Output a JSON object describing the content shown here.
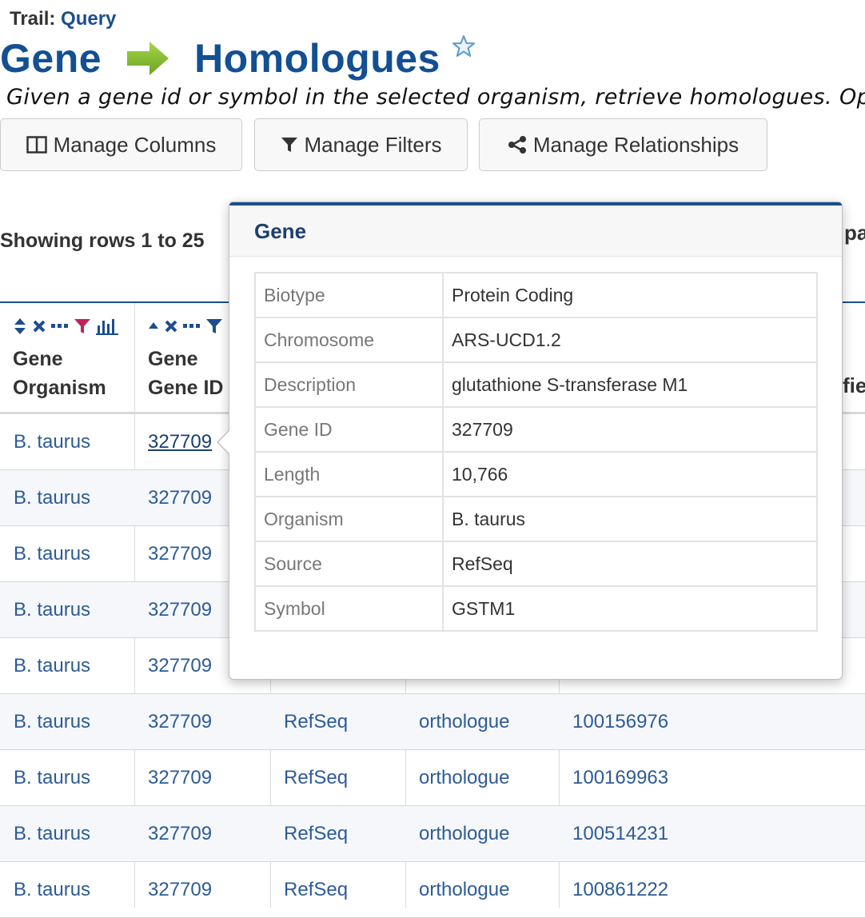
{
  "trail": {
    "label": "Trail:",
    "link": "Query"
  },
  "title": {
    "from": "Gene",
    "to": "Homologues"
  },
  "description": "Given a gene id or symbol in the selected organism, retrieve homologues. Optio",
  "toolbar": {
    "manage_columns": "Manage Columns",
    "manage_filters": "Manage Filters",
    "manage_relationships": "Manage Relationships"
  },
  "showing": "Showing rows 1 to 25",
  "right_fragment": "pa",
  "header_fragment": "fie",
  "columns": [
    {
      "line1": "Gene",
      "line2": "Organism"
    },
    {
      "line1": "Gene",
      "line2": "Gene ID"
    }
  ],
  "rows": [
    {
      "organism": "B. taurus",
      "gene_id": "327709",
      "source": "",
      "type": "",
      "homologue_id": ""
    },
    {
      "organism": "B. taurus",
      "gene_id": "327709",
      "source": "",
      "type": "",
      "homologue_id": ""
    },
    {
      "organism": "B. taurus",
      "gene_id": "327709",
      "source": "",
      "type": "",
      "homologue_id": ""
    },
    {
      "organism": "B. taurus",
      "gene_id": "327709",
      "source": "",
      "type": "",
      "homologue_id": ""
    },
    {
      "organism": "B. taurus",
      "gene_id": "327709",
      "source": "",
      "type": "",
      "homologue_id": ""
    },
    {
      "organism": "B. taurus",
      "gene_id": "327709",
      "source": "RefSeq",
      "type": "orthologue",
      "homologue_id": "100156976"
    },
    {
      "organism": "B. taurus",
      "gene_id": "327709",
      "source": "RefSeq",
      "type": "orthologue",
      "homologue_id": "100169963"
    },
    {
      "organism": "B. taurus",
      "gene_id": "327709",
      "source": "RefSeq",
      "type": "orthologue",
      "homologue_id": "100514231"
    },
    {
      "organism": "B. taurus",
      "gene_id": "327709",
      "source": "RefSeq",
      "type": "orthologue",
      "homologue_id": "100861222"
    }
  ],
  "popover": {
    "title": "Gene",
    "fields": [
      {
        "key": "Biotype",
        "value": "Protein Coding"
      },
      {
        "key": "Chromosome",
        "value": "ARS-UCD1.2"
      },
      {
        "key": "Description",
        "value": "glutathione S-transferase M1"
      },
      {
        "key": "Gene ID",
        "value": "327709"
      },
      {
        "key": "Length",
        "value": "10,766"
      },
      {
        "key": "Organism",
        "value": "B. taurus"
      },
      {
        "key": "Source",
        "value": "RefSeq"
      },
      {
        "key": "Symbol",
        "value": "GSTM1"
      }
    ]
  },
  "colors": {
    "brand": "#124f93",
    "link": "#2d5b97",
    "filter_active": "#c0245a"
  }
}
